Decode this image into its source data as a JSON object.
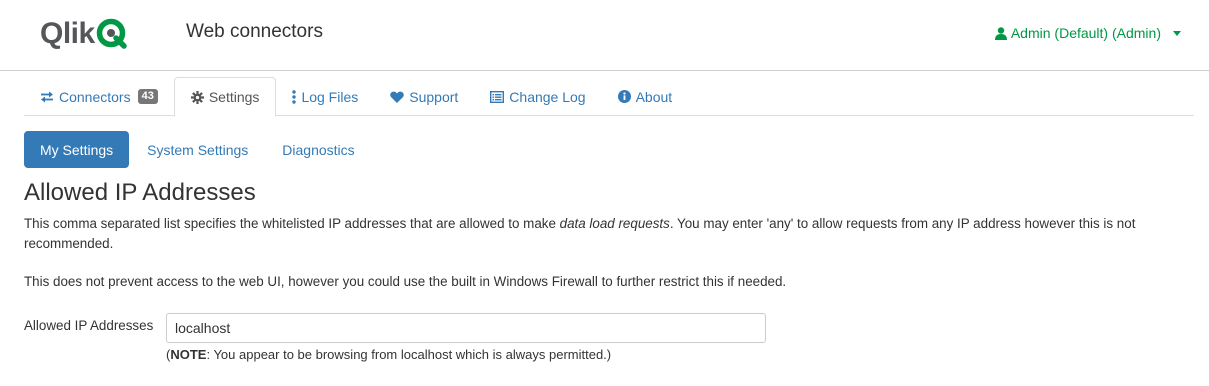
{
  "header": {
    "logo_text": "Qlik",
    "app_title": "Web connectors",
    "user_label": "Admin (Default) (Admin)",
    "accent_color": "#009845"
  },
  "tabs": [
    {
      "label": "Connectors",
      "icon": "exchange-icon",
      "badge": "43"
    },
    {
      "label": "Settings",
      "icon": "gear-icon",
      "active": true
    },
    {
      "label": "Log Files",
      "icon": "ellipsis-vertical-icon"
    },
    {
      "label": "Support",
      "icon": "heart-icon"
    },
    {
      "label": "Change Log",
      "icon": "list-alt-icon"
    },
    {
      "label": "About",
      "icon": "info-circle-icon"
    }
  ],
  "subtabs": [
    {
      "label": "My Settings",
      "active": true
    },
    {
      "label": "System Settings"
    },
    {
      "label": "Diagnostics"
    }
  ],
  "section": {
    "title": "Allowed IP Addresses",
    "para1_before": "This comma separated list specifies the whitelisted IP addresses that are allowed to make ",
    "para1_emph": "data load requests",
    "para1_after": ". You may enter 'any' to allow requests from any IP address however this is not recommended.",
    "para2": "This does not prevent access to the web UI, however you could use the built in Windows Firewall to further restrict this if needed.",
    "field_label": "Allowed IP Addresses",
    "field_value": "localhost",
    "note_open": "(",
    "note_bold": "NOTE",
    "note_rest": ": You appear to be browsing from localhost which is always permitted.)"
  }
}
